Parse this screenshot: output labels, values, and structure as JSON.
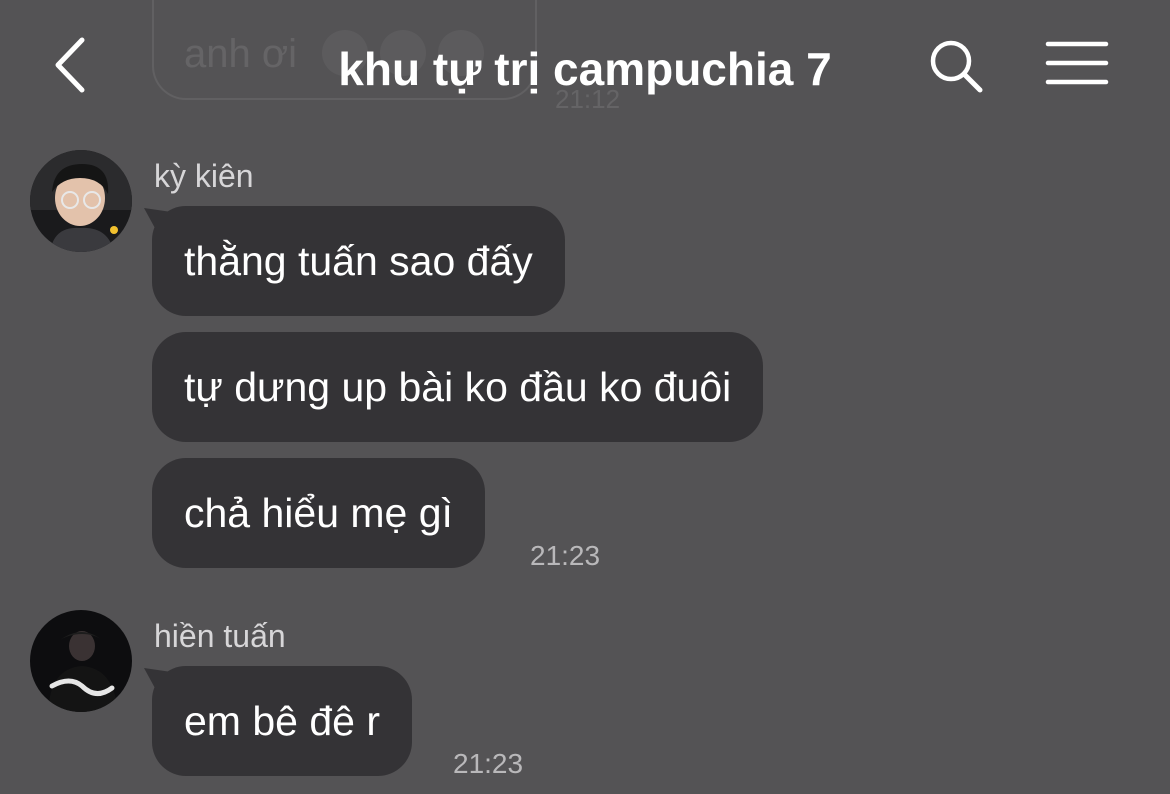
{
  "header": {
    "title": "khu tự trị campuchia 7",
    "back_icon": "chevron-left-icon",
    "search_icon": "search-icon",
    "menu_icon": "hamburger-menu-icon"
  },
  "previous_message": {
    "text": "anh ơi",
    "time": "21:12"
  },
  "groups": [
    {
      "sender": "kỳ kiên",
      "messages": [
        "thằng tuấn sao đấy",
        "tự dưng up bài ko đầu ko đuôi",
        "chả hiểu mẹ gì"
      ],
      "time": "21:23"
    },
    {
      "sender": "hiền tuấn",
      "messages": [
        "em bê đê r"
      ],
      "time": "21:23"
    }
  ],
  "colors": {
    "background": "#545355",
    "bubble": "#343336",
    "text": "#ffffff",
    "meta_text": "#b9b8ba"
  }
}
